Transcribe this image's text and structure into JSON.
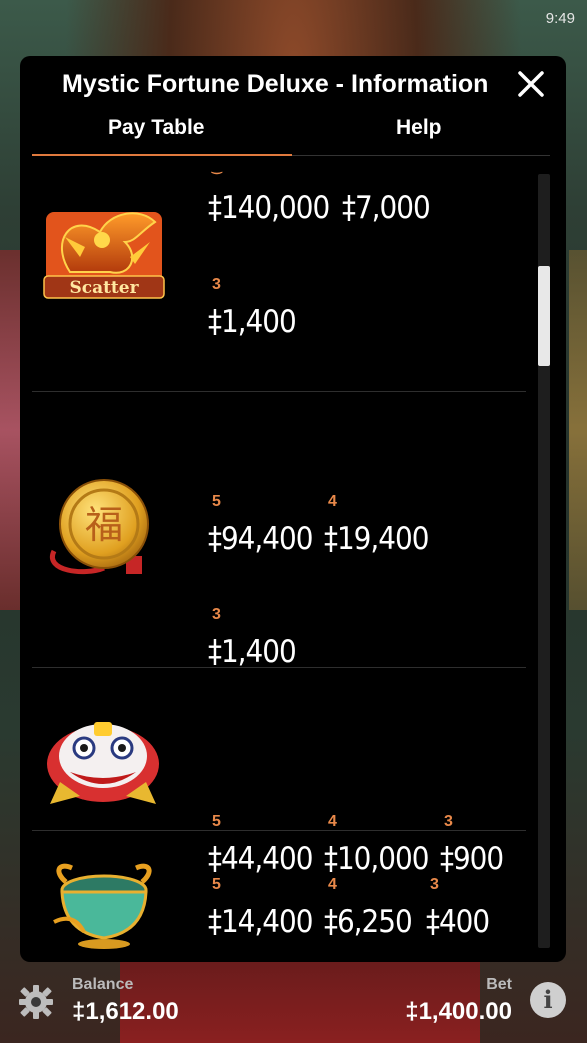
{
  "status": {
    "time": "9:49"
  },
  "dialog": {
    "title": "Mystic Fortune Deluxe - Information",
    "close_icon": "close-icon",
    "tabs": [
      {
        "label": "Pay Table",
        "active": true
      },
      {
        "label": "Help",
        "active": false
      }
    ]
  },
  "paytable": {
    "scatter": {
      "symbol_label": "Scatter",
      "top_values": [
        "‡140,000",
        "‡7,000"
      ],
      "count_3": "3",
      "value_3": "‡1,400"
    },
    "coin": {
      "count_5": "5",
      "value_5": "‡94,400",
      "count_4": "4",
      "value_4": "‡19,400",
      "count_3": "3",
      "value_3": "‡1,400"
    },
    "lion": {
      "count_5": "5",
      "value_5": "‡44,400",
      "count_4": "4",
      "value_4": "‡10,000",
      "count_3": "3",
      "value_3": "‡900"
    },
    "bowl": {
      "count_5": "5",
      "value_5": "‡14,400",
      "count_4": "4",
      "value_4": "‡6,250",
      "count_3": "3",
      "value_3": "‡400"
    }
  },
  "footer": {
    "balance_label": "Balance",
    "balance_value": "‡1,612.00",
    "bet_label": "Bet",
    "bet_value": "‡1,400.00",
    "settings_icon": "gear-icon",
    "info_icon": "info-icon",
    "info_glyph": "i"
  }
}
